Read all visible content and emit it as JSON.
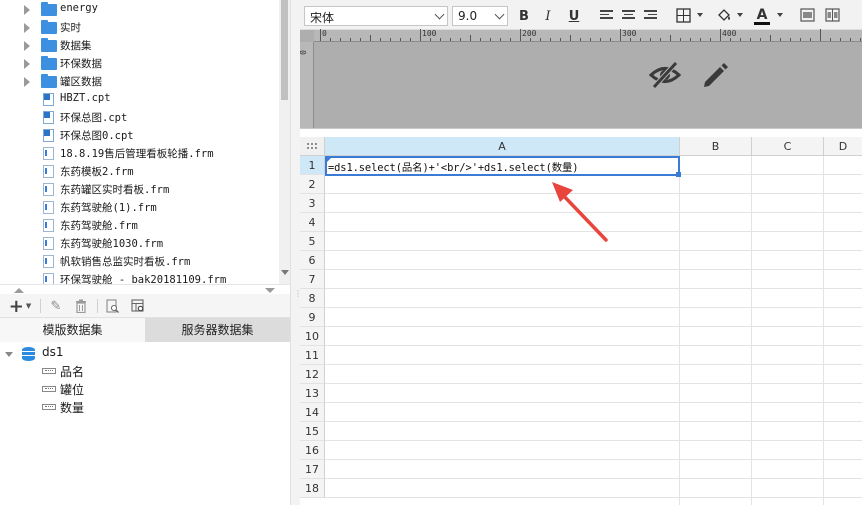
{
  "file_tree": {
    "items": [
      {
        "type": "folder",
        "label": "energy"
      },
      {
        "type": "folder",
        "label": "实时"
      },
      {
        "type": "folder",
        "label": "数据集"
      },
      {
        "type": "folder",
        "label": "环保数据"
      },
      {
        "type": "folder",
        "label": "罐区数据"
      },
      {
        "type": "cpt",
        "label": "HBZT.cpt"
      },
      {
        "type": "cpt",
        "label": "环保总图.cpt"
      },
      {
        "type": "cpt",
        "label": "环保总图0.cpt"
      },
      {
        "type": "frm",
        "label": "18.8.19售后管理看板轮播.frm"
      },
      {
        "type": "frm",
        "label": "东药模板2.frm"
      },
      {
        "type": "frm",
        "label": "东药罐区实时看板.frm"
      },
      {
        "type": "frm",
        "label": "东药驾驶舱(1).frm"
      },
      {
        "type": "frm",
        "label": "东药驾驶舱.frm"
      },
      {
        "type": "frm",
        "label": "东药驾驶舱1030.frm"
      },
      {
        "type": "frm",
        "label": "帆软销售总监实时看板.frm"
      },
      {
        "type": "frm",
        "label": "环保驾驶舱 - bak20181109.frm"
      }
    ]
  },
  "dataset_panel": {
    "tabs": {
      "template": "模版数据集",
      "server": "服务器数据集"
    },
    "dataset_name": "ds1",
    "fields": [
      "品名",
      "罐位",
      "数量"
    ]
  },
  "format_toolbar": {
    "font_name": "宋体",
    "font_size": "9.0",
    "bold": "B",
    "italic": "I",
    "underline": "U",
    "font_color_glyph": "A"
  },
  "ruler": {
    "h_labels": [
      "0",
      "100",
      "200",
      "300",
      "400"
    ],
    "v_labels": [
      "0"
    ]
  },
  "sheet": {
    "columns": [
      "A",
      "B",
      "C",
      "D"
    ],
    "rows": [
      "1",
      "2",
      "3",
      "4",
      "5",
      "6",
      "7",
      "8",
      "9",
      "10",
      "11",
      "12",
      "13",
      "14",
      "15",
      "16",
      "17",
      "18"
    ],
    "selected_cell": "A1",
    "a1_value": "=ds1.select(品名)+'<br/>'+ds1.select(数量)"
  },
  "colors": {
    "folder": "#3d8fe0",
    "selection": "#3a7bd5",
    "header_selected": "#cfe8f7",
    "annotation_arrow": "#e8453c",
    "banner_bg": "#aeaeae"
  },
  "icons": {
    "banner_hide": "eye-slash-icon",
    "banner_edit": "pencil-icon"
  }
}
